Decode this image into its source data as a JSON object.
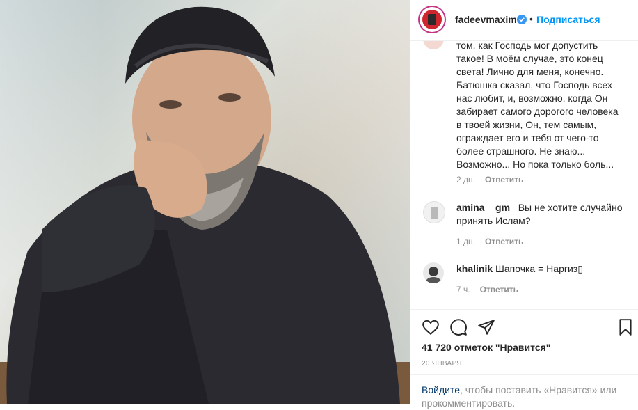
{
  "header": {
    "username": "fadeevmaxim",
    "separator": "•",
    "follow_label": "Подписаться"
  },
  "comments": [
    {
      "text": "том, как Господь мог допустить такое! В моём случае, это конец света! Лично для меня, конечно. Батюшка сказал, что Господь всех нас любит, и, возможно, когда Он забирает самого дорогого человека в твоей жизни, Он, тем самым, ограждает его и тебя от чего-то более страшного. Не знаю... Возможно... Но пока только боль...",
      "time": "2 дн.",
      "reply_label": "Ответить"
    },
    {
      "username": "amina__gm_",
      "text": "Вы не хотите случайно принять Ислам?",
      "time": "1 дн.",
      "reply_label": "Ответить"
    },
    {
      "username": "khalinik",
      "text": "Шапочка = Наргиз▯",
      "time": "7 ч.",
      "reply_label": "Ответить"
    }
  ],
  "actions": {
    "likes_text": "41 720 отметок \"Нравится\"",
    "date": "20 ЯНВАРЯ",
    "icons": [
      "heart-icon",
      "comment-icon",
      "share-icon",
      "bookmark-icon"
    ]
  },
  "login": {
    "link_label": "Войдите",
    "rest_text": ", чтобы поставить «Нравится» или прокомментировать."
  },
  "colors": {
    "accent": "#0095f6",
    "muted": "#8e8e8e",
    "border": "#efefef"
  }
}
